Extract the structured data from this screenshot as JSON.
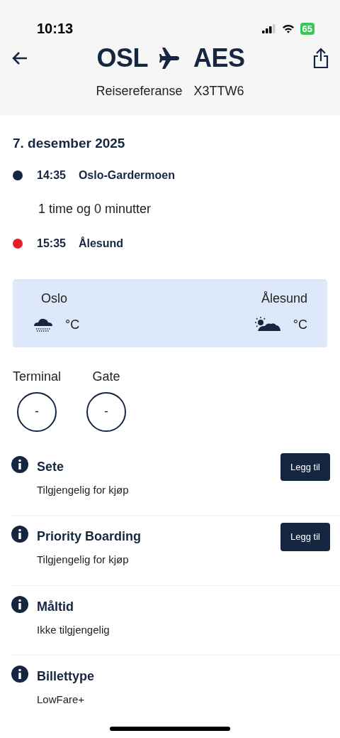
{
  "status_bar": {
    "time": "10:13",
    "battery": "65"
  },
  "header": {
    "origin": "OSL",
    "destination": "AES",
    "reference_label": "Reisereferanse",
    "reference": "X3TTW6"
  },
  "date": "7. desember 2025",
  "itinerary": [
    {
      "kind": "stop",
      "time": "14:35",
      "place": "Oslo-Gardermoen",
      "color": "#152641"
    },
    {
      "kind": "duration",
      "text": "1 time og 0 minutter"
    },
    {
      "kind": "stop",
      "time": "15:35",
      "place": "Ålesund",
      "color": "#e3212b"
    }
  ],
  "weather": [
    {
      "city": "Oslo",
      "kind": "rain",
      "unit": "°C"
    },
    {
      "city": "Ålesund",
      "kind": "partly-sunny",
      "unit": "°C"
    }
  ],
  "gates": [
    {
      "label": "Terminal",
      "value": "-"
    },
    {
      "label": "Gate",
      "value": "-"
    }
  ],
  "services": [
    {
      "title": "Sete",
      "subtitle": "Tilgjengelig for kjøp",
      "button": "Legg til"
    },
    {
      "title": "Priority Boarding",
      "subtitle": "Tilgjengelig for kjøp",
      "button": "Legg til"
    },
    {
      "title": "Måltid",
      "subtitle": "Ikke tilgjengelig"
    },
    {
      "title": "Billettype",
      "subtitle": "LowFare+"
    }
  ]
}
